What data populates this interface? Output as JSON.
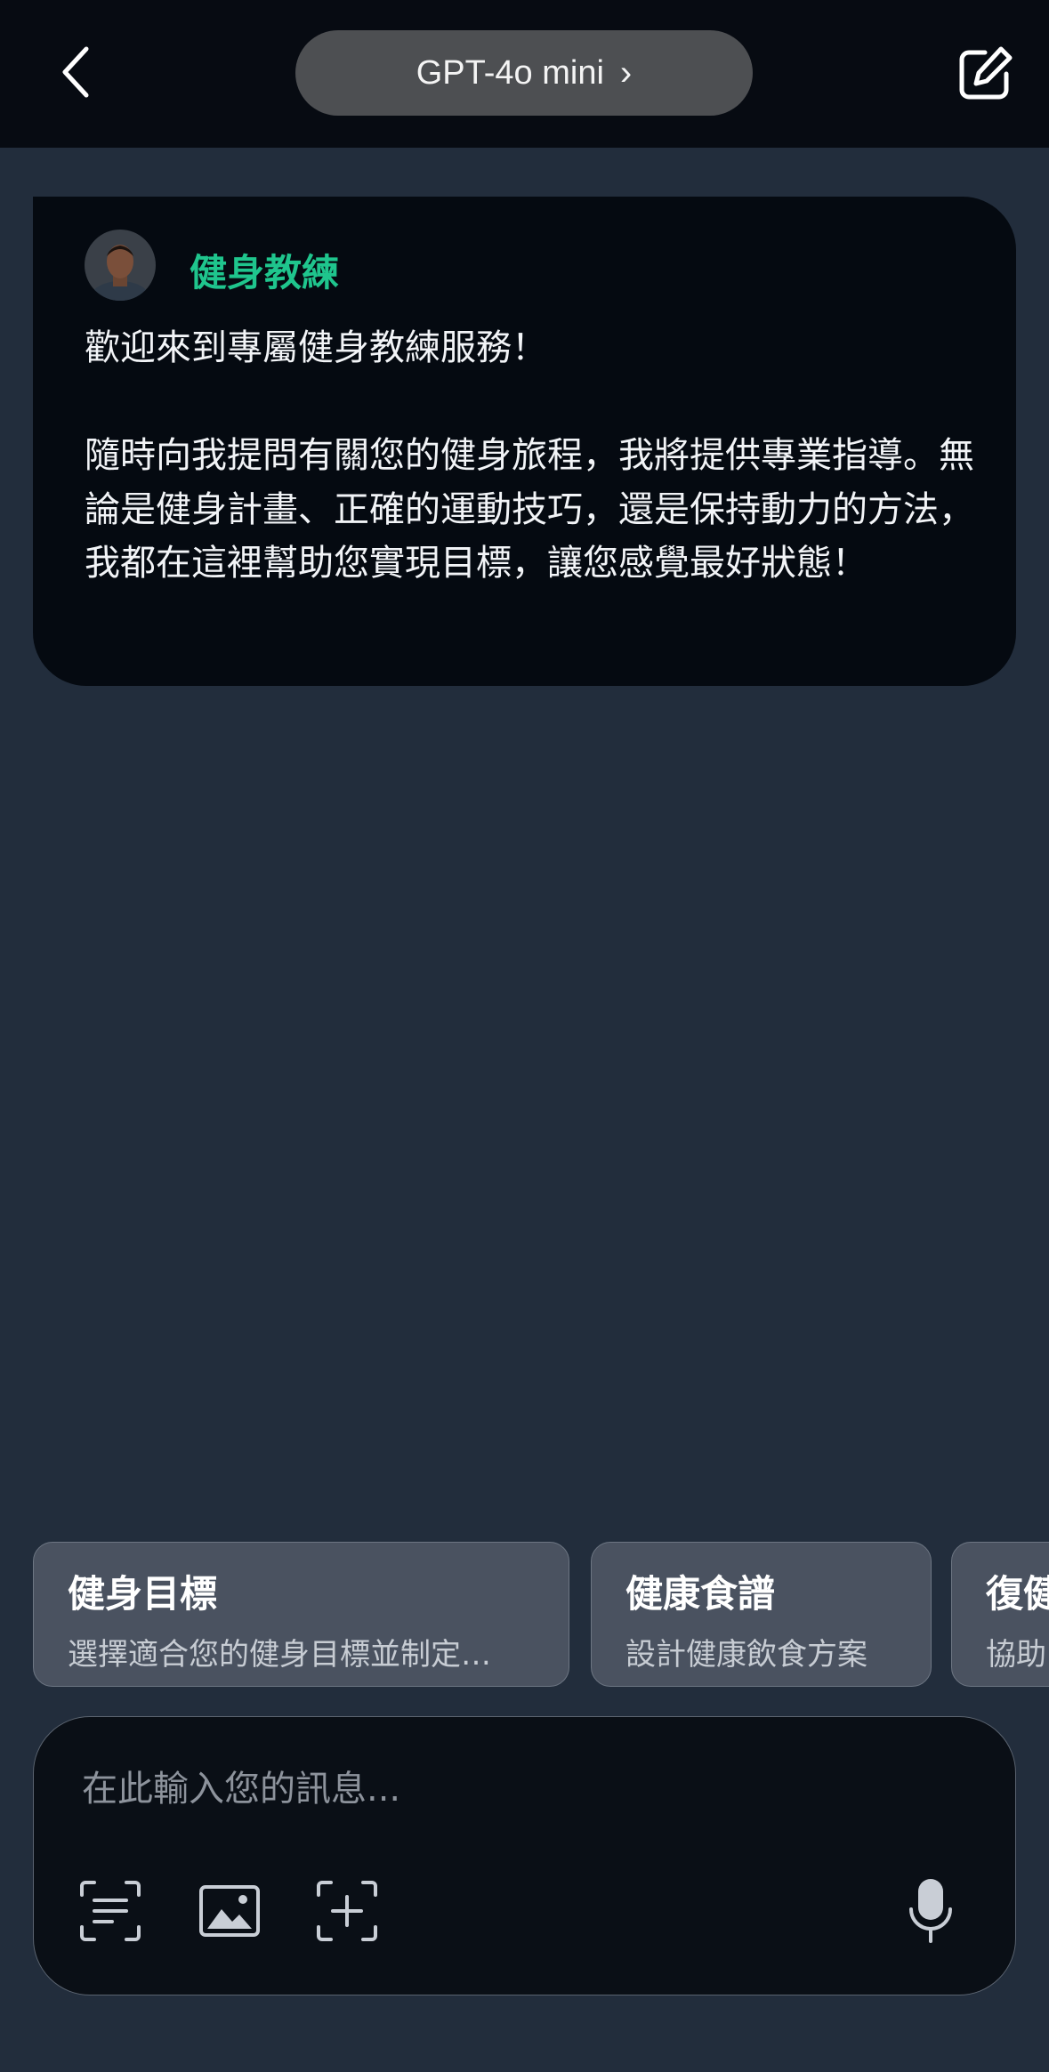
{
  "header": {
    "model_name": "GPT-4o mini",
    "chevron": "›",
    "back_icon": "chevron-left-icon",
    "edit_icon": "edit-icon"
  },
  "bot": {
    "name": "健身教練",
    "message": "歡迎來到專屬健身教練服務！\n\n隨時向我提問有關您的健身旅程，我將提供專業指導。無論是健身計畫、正確的運動技巧，還是保持動力的方法，我都在這裡幫助您實現目標，讓您感覺最好狀態！",
    "name_color": "#1fc58d"
  },
  "suggestions": [
    {
      "title": "健身目標",
      "subtitle": "選擇適合您的健身目標並制定…"
    },
    {
      "title": "健康食譜",
      "subtitle": "設計健康飲食方案"
    },
    {
      "title": "復健",
      "subtitle": "協助"
    }
  ],
  "composer": {
    "placeholder": "在此輸入您的訊息...",
    "tools": [
      "text-scan-icon",
      "image-icon",
      "add-frame-icon"
    ],
    "mic_icon": "microphone-icon"
  }
}
